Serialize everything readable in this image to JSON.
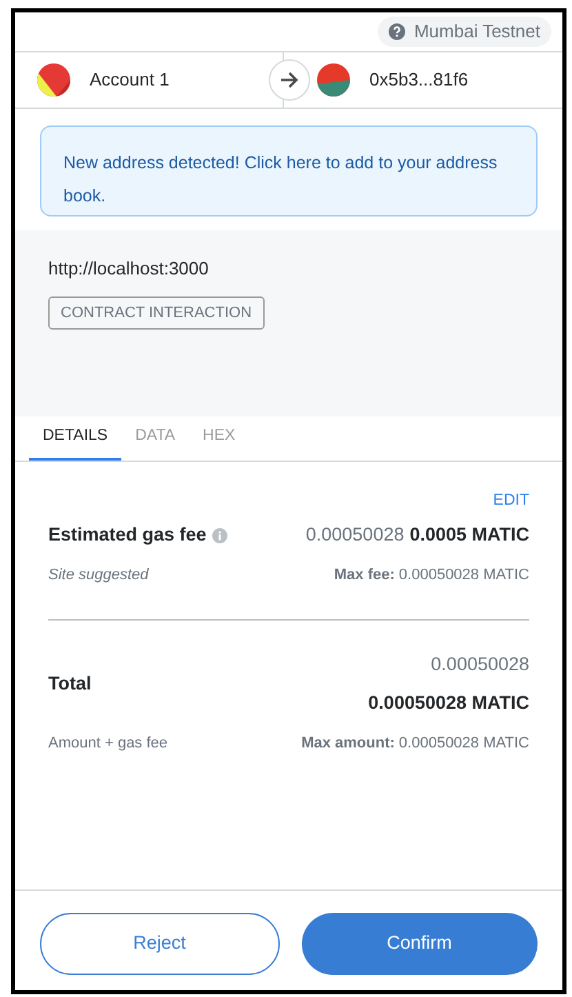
{
  "network": {
    "name": "Mumbai Testnet"
  },
  "sender": {
    "name": "Account 1"
  },
  "recipient": {
    "address": "0x5b3...81f6"
  },
  "alert": {
    "text": "New address detected! Click here to add to your address book."
  },
  "origin": {
    "url": "http://localhost:3000",
    "badge": "CONTRACT INTERACTION"
  },
  "tabs": [
    {
      "label": "DETAILS",
      "selected": true
    },
    {
      "label": "DATA",
      "selected": false
    },
    {
      "label": "HEX",
      "selected": false
    }
  ],
  "edit_link": "EDIT",
  "gas_fee": {
    "label": "Estimated gas fee",
    "secondary_value": "0.00050028",
    "primary_value": "0.0005 MATIC",
    "subtitle": "Site suggested",
    "max_label": "Max fee:",
    "max_value": "0.00050028 MATIC"
  },
  "total": {
    "label": "Total",
    "secondary_value": "0.00050028",
    "primary_value": "0.00050028 MATIC",
    "subtitle": "Amount + gas fee",
    "max_label": "Max amount:",
    "max_value": "0.00050028 MATIC"
  },
  "buttons": {
    "reject": "Reject",
    "confirm": "Confirm"
  }
}
